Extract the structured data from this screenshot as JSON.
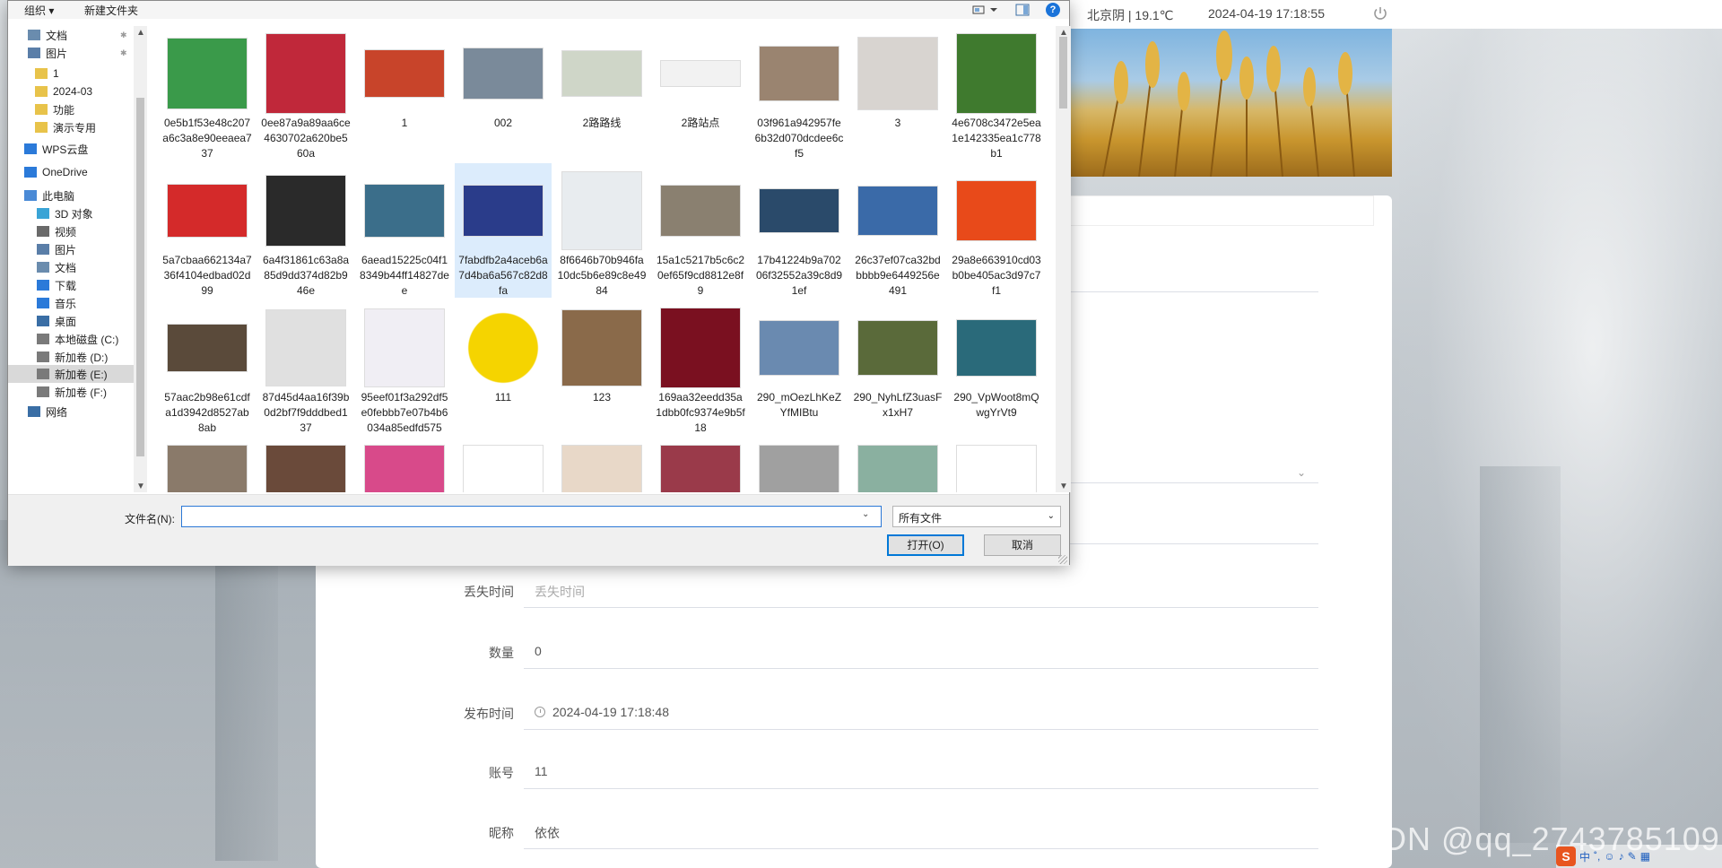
{
  "topbar": {
    "weather": "北京阴 | 19.1℃",
    "clock": "2024-04-19  17:18:55"
  },
  "form": {
    "lost_time": {
      "label": "丢失时间",
      "placeholder": "丢失时间"
    },
    "quantity": {
      "label": "数量",
      "value": "0"
    },
    "publish_time": {
      "label": "发布时间",
      "value": "2024-04-19 17:18:48"
    },
    "account": {
      "label": "账号",
      "value": "11"
    },
    "nickname": {
      "label": "昵称",
      "value": "依依"
    }
  },
  "watermark": "CSDN @qq_2743785109",
  "tray": {
    "ime": "中"
  },
  "dialog": {
    "toolbar": {
      "organize": "组织 ▾",
      "new_folder": "新建文件夹"
    },
    "nav": [
      {
        "label": "文档",
        "icon": "document-icon",
        "pinned": true
      },
      {
        "label": "图片",
        "icon": "pictures-icon",
        "pinned": true
      },
      {
        "label": "1",
        "icon": "folder-icon"
      },
      {
        "label": "2024-03",
        "icon": "folder-icon"
      },
      {
        "label": "功能",
        "icon": "folder-icon"
      },
      {
        "label": "演示专用",
        "icon": "folder-icon"
      },
      {
        "label": "WPS云盘",
        "icon": "cloud-icon"
      },
      {
        "label": "OneDrive",
        "icon": "onedrive-icon"
      },
      {
        "label": "此电脑",
        "icon": "computer-icon"
      },
      {
        "label": "3D 对象",
        "icon": "3d-objects-icon"
      },
      {
        "label": "视频",
        "icon": "videos-icon"
      },
      {
        "label": "图片",
        "icon": "pictures-icon"
      },
      {
        "label": "文档",
        "icon": "document-icon"
      },
      {
        "label": "下载",
        "icon": "download-icon"
      },
      {
        "label": "音乐",
        "icon": "music-icon"
      },
      {
        "label": "桌面",
        "icon": "desktop-icon"
      },
      {
        "label": "本地磁盘 (C:)",
        "icon": "drive-icon"
      },
      {
        "label": "新加卷 (D:)",
        "icon": "drive-icon"
      },
      {
        "label": "新加卷 (E:)",
        "icon": "drive-icon",
        "selected": true
      },
      {
        "label": "新加卷 (F:)",
        "icon": "drive-icon"
      },
      {
        "label": "网络",
        "icon": "network-icon"
      }
    ],
    "files": [
      {
        "name": "0e5b1f53e48c207a6c3a8e90eeaea737",
        "color": "#3a9a4a"
      },
      {
        "name": "0ee87a9a89aa6ce4630702a620be560a",
        "color": "#c0283a"
      },
      {
        "name": "1",
        "color": "#c8442a"
      },
      {
        "name": "002",
        "color": "#7a8a9a"
      },
      {
        "name": "2路路线",
        "color": "#cfd6c8"
      },
      {
        "name": "2路站点",
        "color": "#f2f2f2"
      },
      {
        "name": "03f961a942957fe6b32d070dcdee6cf5",
        "color": "#9a8470"
      },
      {
        "name": "3",
        "color": "#d8d4d0"
      },
      {
        "name": "4e6708c3472e5ea1e142335ea1c778b1",
        "color": "#3f7a2e"
      },
      {
        "name": "5a7cbaa662134a736f4104edbad02d99",
        "color": "#d42a2a"
      },
      {
        "name": "6a4f31861c63a8a85d9dd374d82b946e",
        "color": "#2a2a2a"
      },
      {
        "name": "6aead15225c04f18349b44ff14827dee",
        "color": "#3b6e8a"
      },
      {
        "name": "7fabdfb2a4aceb6a7d4ba6a567c82d8fa",
        "color": "#2a3c8a",
        "selected": true
      },
      {
        "name": "8f6646b70b946fa10dc5b6e89c8e4984",
        "color": "#e8ecef"
      },
      {
        "name": "15a1c5217b5c6c20ef65f9cd8812e8f9",
        "color": "#8a8070"
      },
      {
        "name": "17b41224b9a70206f32552a39c8d91ef",
        "color": "#2a4a6a"
      },
      {
        "name": "26c37ef07ca32bdbbbb9e6449256e491",
        "color": "#3a6aa8"
      },
      {
        "name": "29a8e663910cd03b0be405ac3d97c7f1",
        "color": "#e84a1a"
      },
      {
        "name": "57aac2b98e61cdfa1d3942d8527ab8ab",
        "color": "#5a4a3a"
      },
      {
        "name": "87d45d4aa16f39b0d2bf7f9dddbed137",
        "color": "#e0e0e0"
      },
      {
        "name": "95eef01f3a292df5e0febbb7e07b4b6034a85edfd575",
        "color": "#f0eef4"
      },
      {
        "name": "111",
        "color": "#f5d400"
      },
      {
        "name": "123",
        "color": "#8a6a4a"
      },
      {
        "name": "169aa32eedd35a1dbb0fc9374e9b5f18",
        "color": "#7a1020"
      },
      {
        "name": "290_mOezLhKeZYfMIBtu",
        "color": "#6a8ab0"
      },
      {
        "name": "290_NyhLfZ3uasFx1xH7",
        "color": "#5a6a3a"
      },
      {
        "name": "290_VpWoot8mQwgYrVt9",
        "color": "#2a6a7a"
      },
      {
        "name": "",
        "color": "#8a7a6a"
      },
      {
        "name": "",
        "color": "#6a4a3a"
      },
      {
        "name": "",
        "color": "#d84a8a"
      },
      {
        "name": "",
        "color": "#ffffff"
      },
      {
        "name": "",
        "color": "#e8d8c8"
      },
      {
        "name": "",
        "color": "#9a3a4a"
      },
      {
        "name": "",
        "color": "#a0a0a0"
      },
      {
        "name": "",
        "color": "#8ab0a0"
      },
      {
        "name": "",
        "color": "#ffffff"
      }
    ],
    "filename_label": "文件名(N):",
    "filename_value": "",
    "filter_value": "所有文件",
    "open_button": "打开(O)",
    "cancel_button": "取消"
  }
}
